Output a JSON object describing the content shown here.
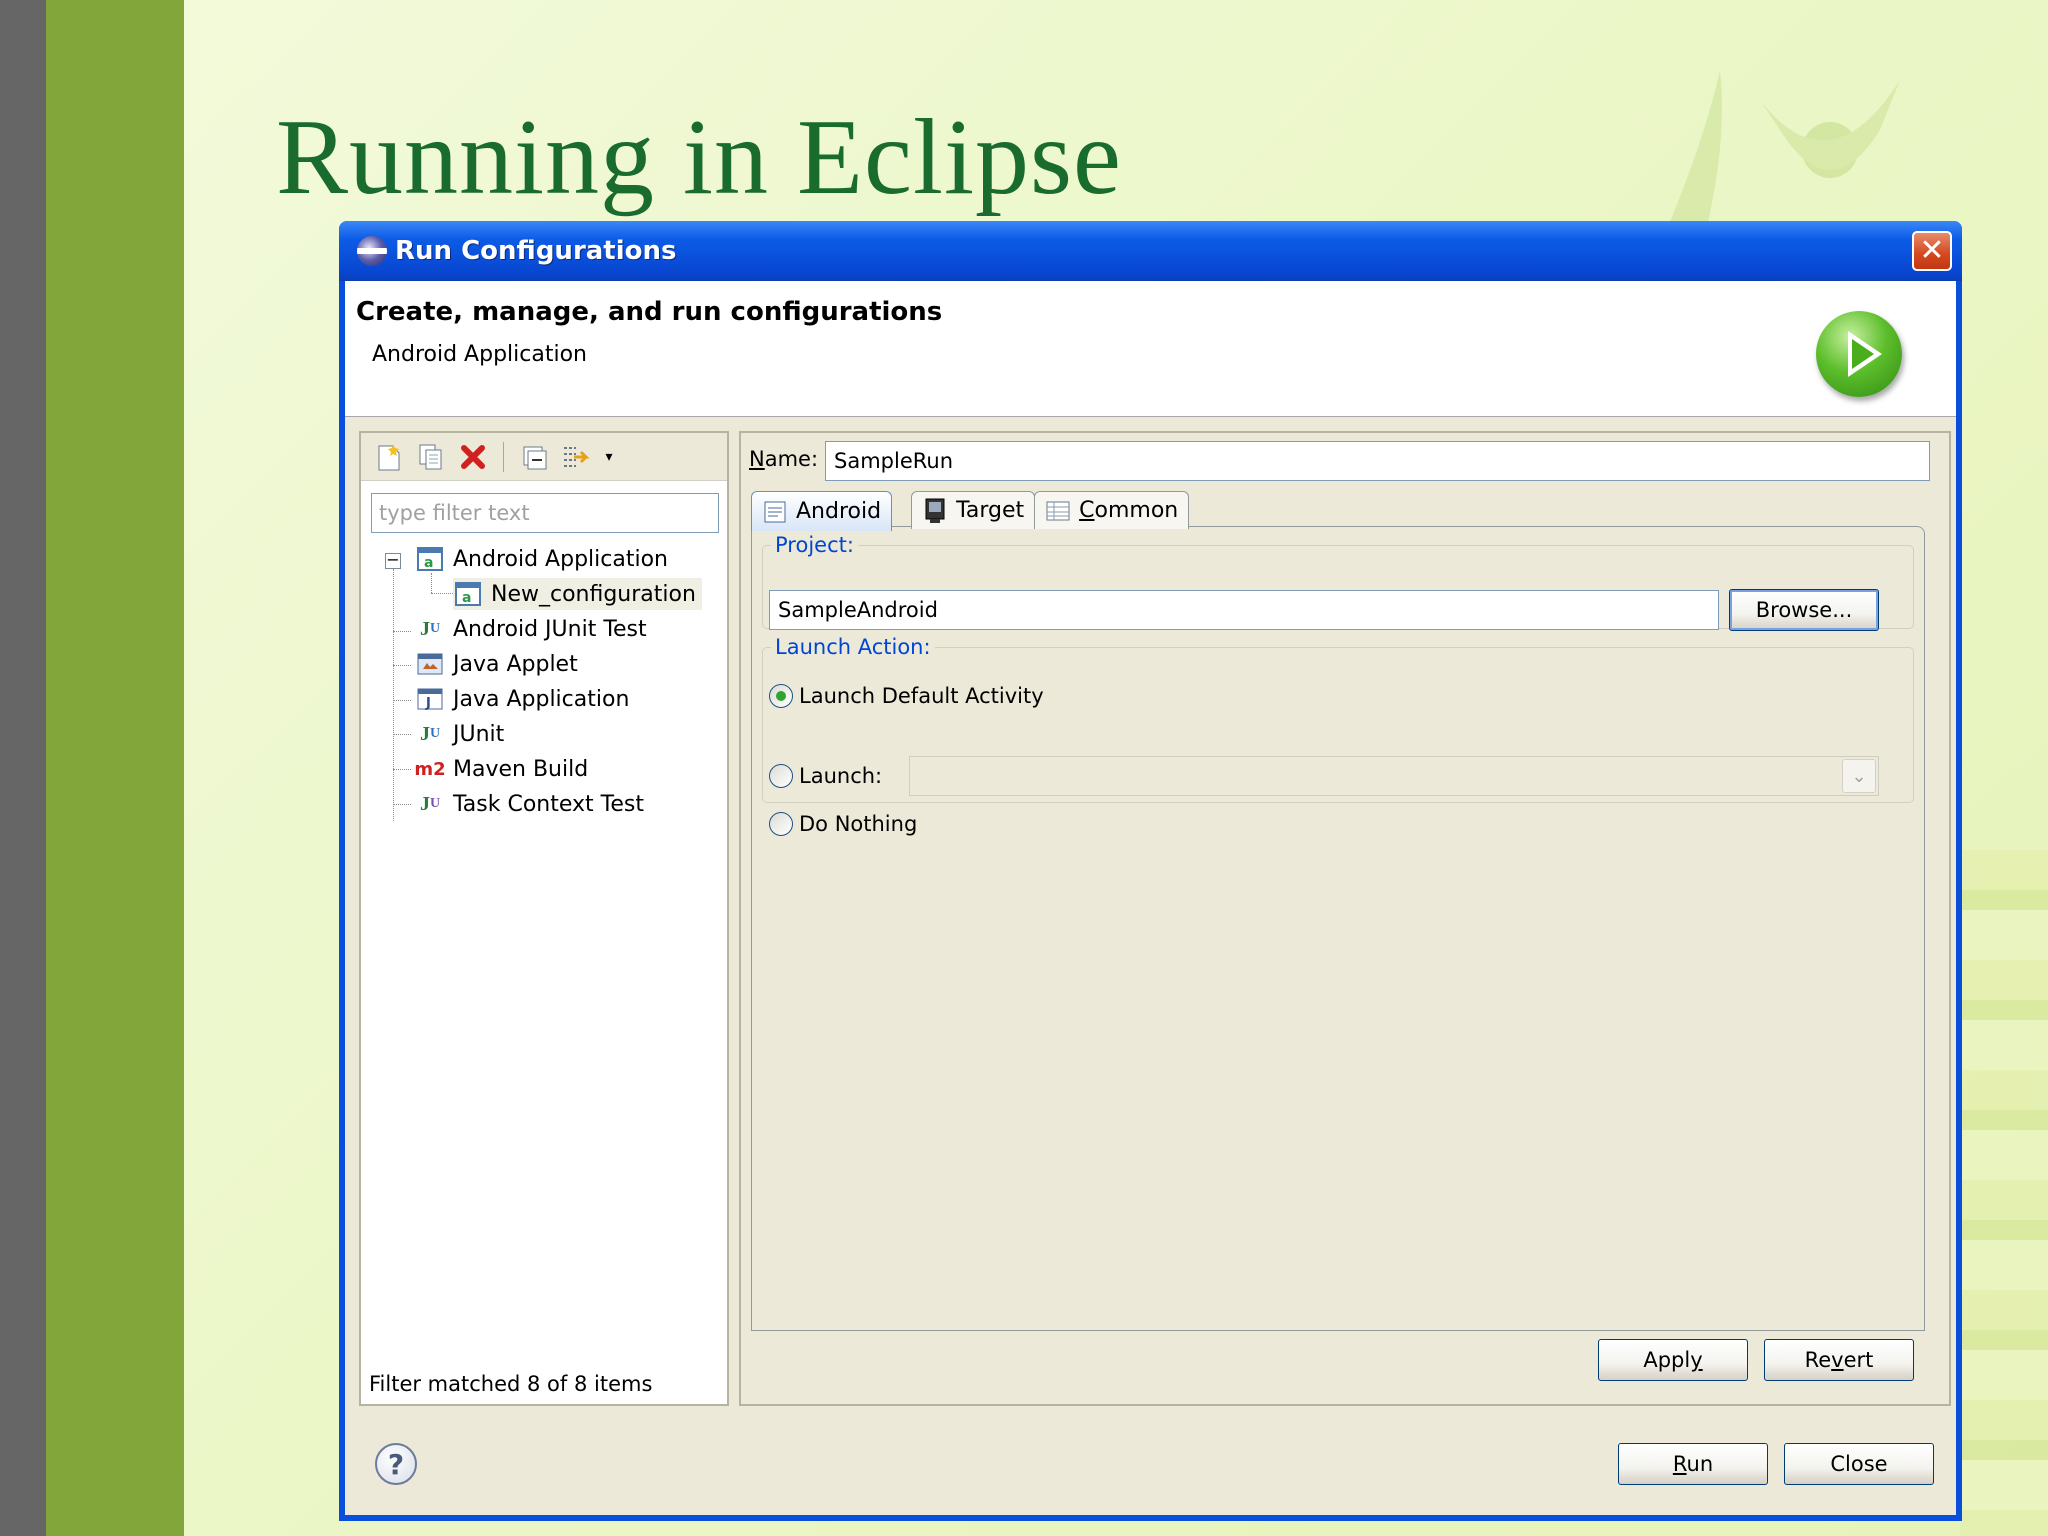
{
  "slide": {
    "title": "Running in Eclipse"
  },
  "window": {
    "title": "Run Configurations",
    "close_symbol": "✕"
  },
  "banner": {
    "heading": "Create, manage, and run configurations",
    "subheading": "Android Application"
  },
  "left_panel": {
    "toolbar_icons": [
      "new-config-icon",
      "duplicate-icon",
      "delete-icon",
      "collapse-all-icon",
      "filter-icon",
      "dropdown-arrow-icon"
    ],
    "filter_placeholder": "type filter text",
    "filter_value": "",
    "tree": [
      {
        "label": "Android Application",
        "icon": "android-app-icon",
        "expanded": true
      },
      {
        "label": "New_configuration",
        "icon": "android-app-icon",
        "selected": true
      },
      {
        "label": "Android JUnit Test",
        "icon": "android-junit-icon"
      },
      {
        "label": "Java Applet",
        "icon": "java-applet-icon"
      },
      {
        "label": "Java Application",
        "icon": "java-app-icon"
      },
      {
        "label": "JUnit",
        "icon": "junit-icon"
      },
      {
        "label": "Maven Build",
        "icon": "maven-icon"
      },
      {
        "label": "Task Context Test",
        "icon": "task-context-icon"
      }
    ],
    "status": "Filter matched 8 of 8 items"
  },
  "right_panel": {
    "name_label": "Name:",
    "name_value": "SampleRun",
    "tabs": [
      {
        "label": "Android",
        "icon": "android-tab-icon",
        "active": true
      },
      {
        "label": "Target",
        "icon": "target-tab-icon"
      },
      {
        "label": "Common",
        "icon": "common-tab-icon"
      }
    ],
    "project_group": "Project:",
    "project_value": "SampleAndroid",
    "browse_label": "Browse...",
    "launch_group": "Launch Action:",
    "launch_options": [
      {
        "label": "Launch Default Activity",
        "selected": true
      },
      {
        "label": "Launch:",
        "selected": false
      },
      {
        "label": "Do Nothing",
        "selected": false
      }
    ],
    "launch_select_value": "",
    "apply_label": "Apply",
    "revert_label": "Revert"
  },
  "footer": {
    "run_label": "Run",
    "close_label": "Close",
    "help_symbol": "?"
  },
  "colors": {
    "titlebar": "#0a4fdc",
    "slide_title": "#1a6b2e",
    "group_label": "#0046d5",
    "dialog_bg": "#ece9d8"
  }
}
